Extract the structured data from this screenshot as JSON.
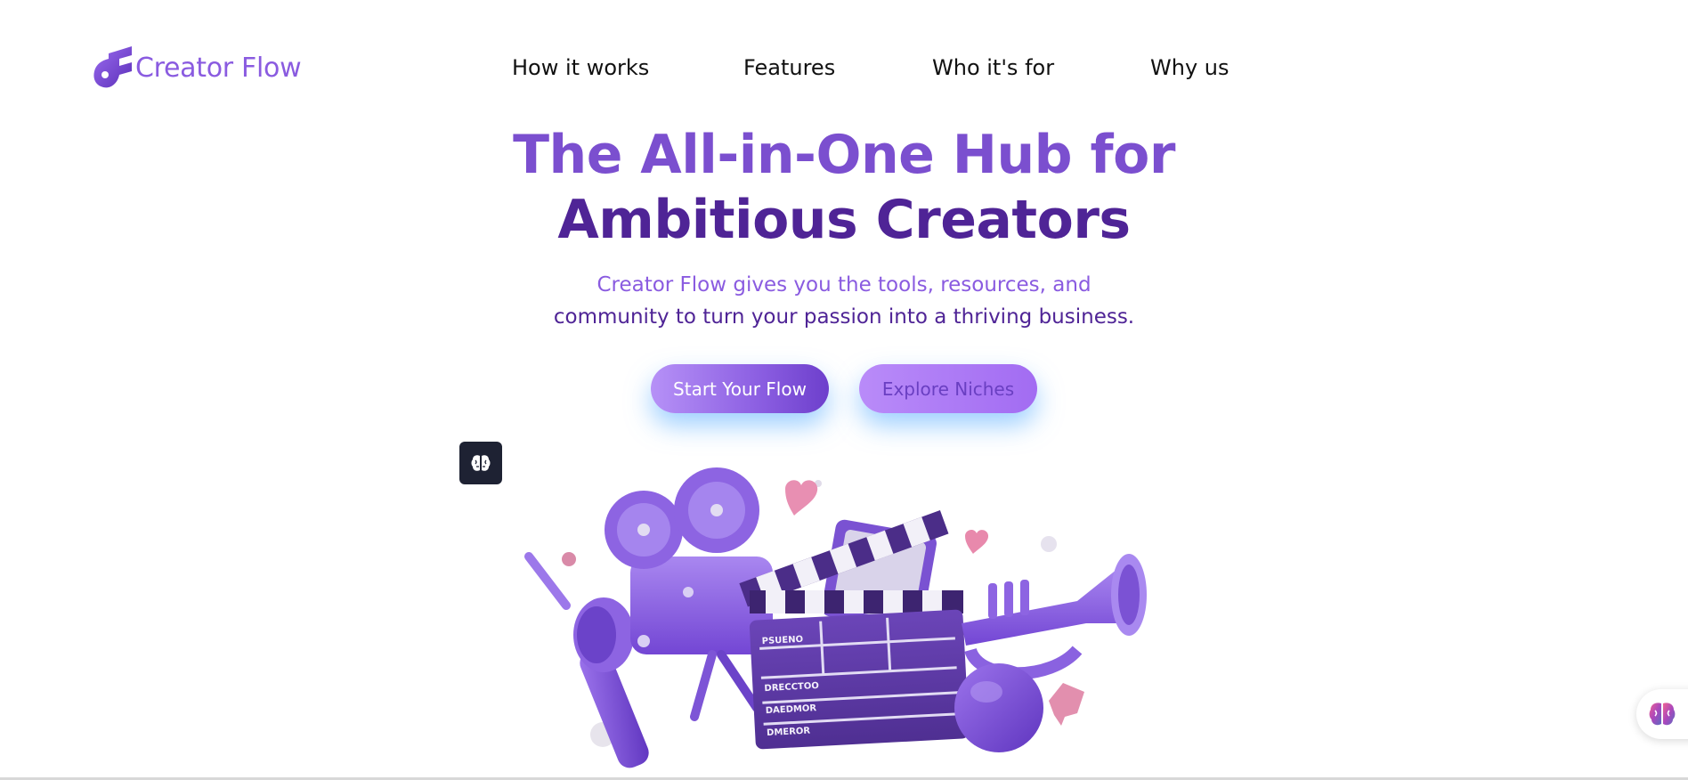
{
  "brand": {
    "name": "Creator Flow",
    "color": "#8a5be0"
  },
  "nav": {
    "items": [
      {
        "label": "How it works"
      },
      {
        "label": "Features"
      },
      {
        "label": "Who it's for"
      },
      {
        "label": "Why us"
      }
    ]
  },
  "hero": {
    "title_line1": "The All-in-One Hub for",
    "title_line2": "Ambitious Creators",
    "subtitle_line1": "Creator Flow gives you the tools, resources, and",
    "subtitle_line2": "community to turn your passion into a thriving business.",
    "primary_cta": "Start Your Flow",
    "secondary_cta": "Explore Niches",
    "illustration_icon": "film-camera-clapperboard-trumpet-illustration"
  },
  "clapperboard": {
    "line1": "PSUENO",
    "line2": "DRECCTOO",
    "line3": "DAEDMOR",
    "line4": "DMEROR"
  },
  "widgets": {
    "brain_button_icon": "brain-icon",
    "floating_button_icon": "brain-icon"
  },
  "colors": {
    "accent": "#8a5be0",
    "accent_dark": "#4f2496",
    "brain_button_bg": "#1e2233"
  }
}
